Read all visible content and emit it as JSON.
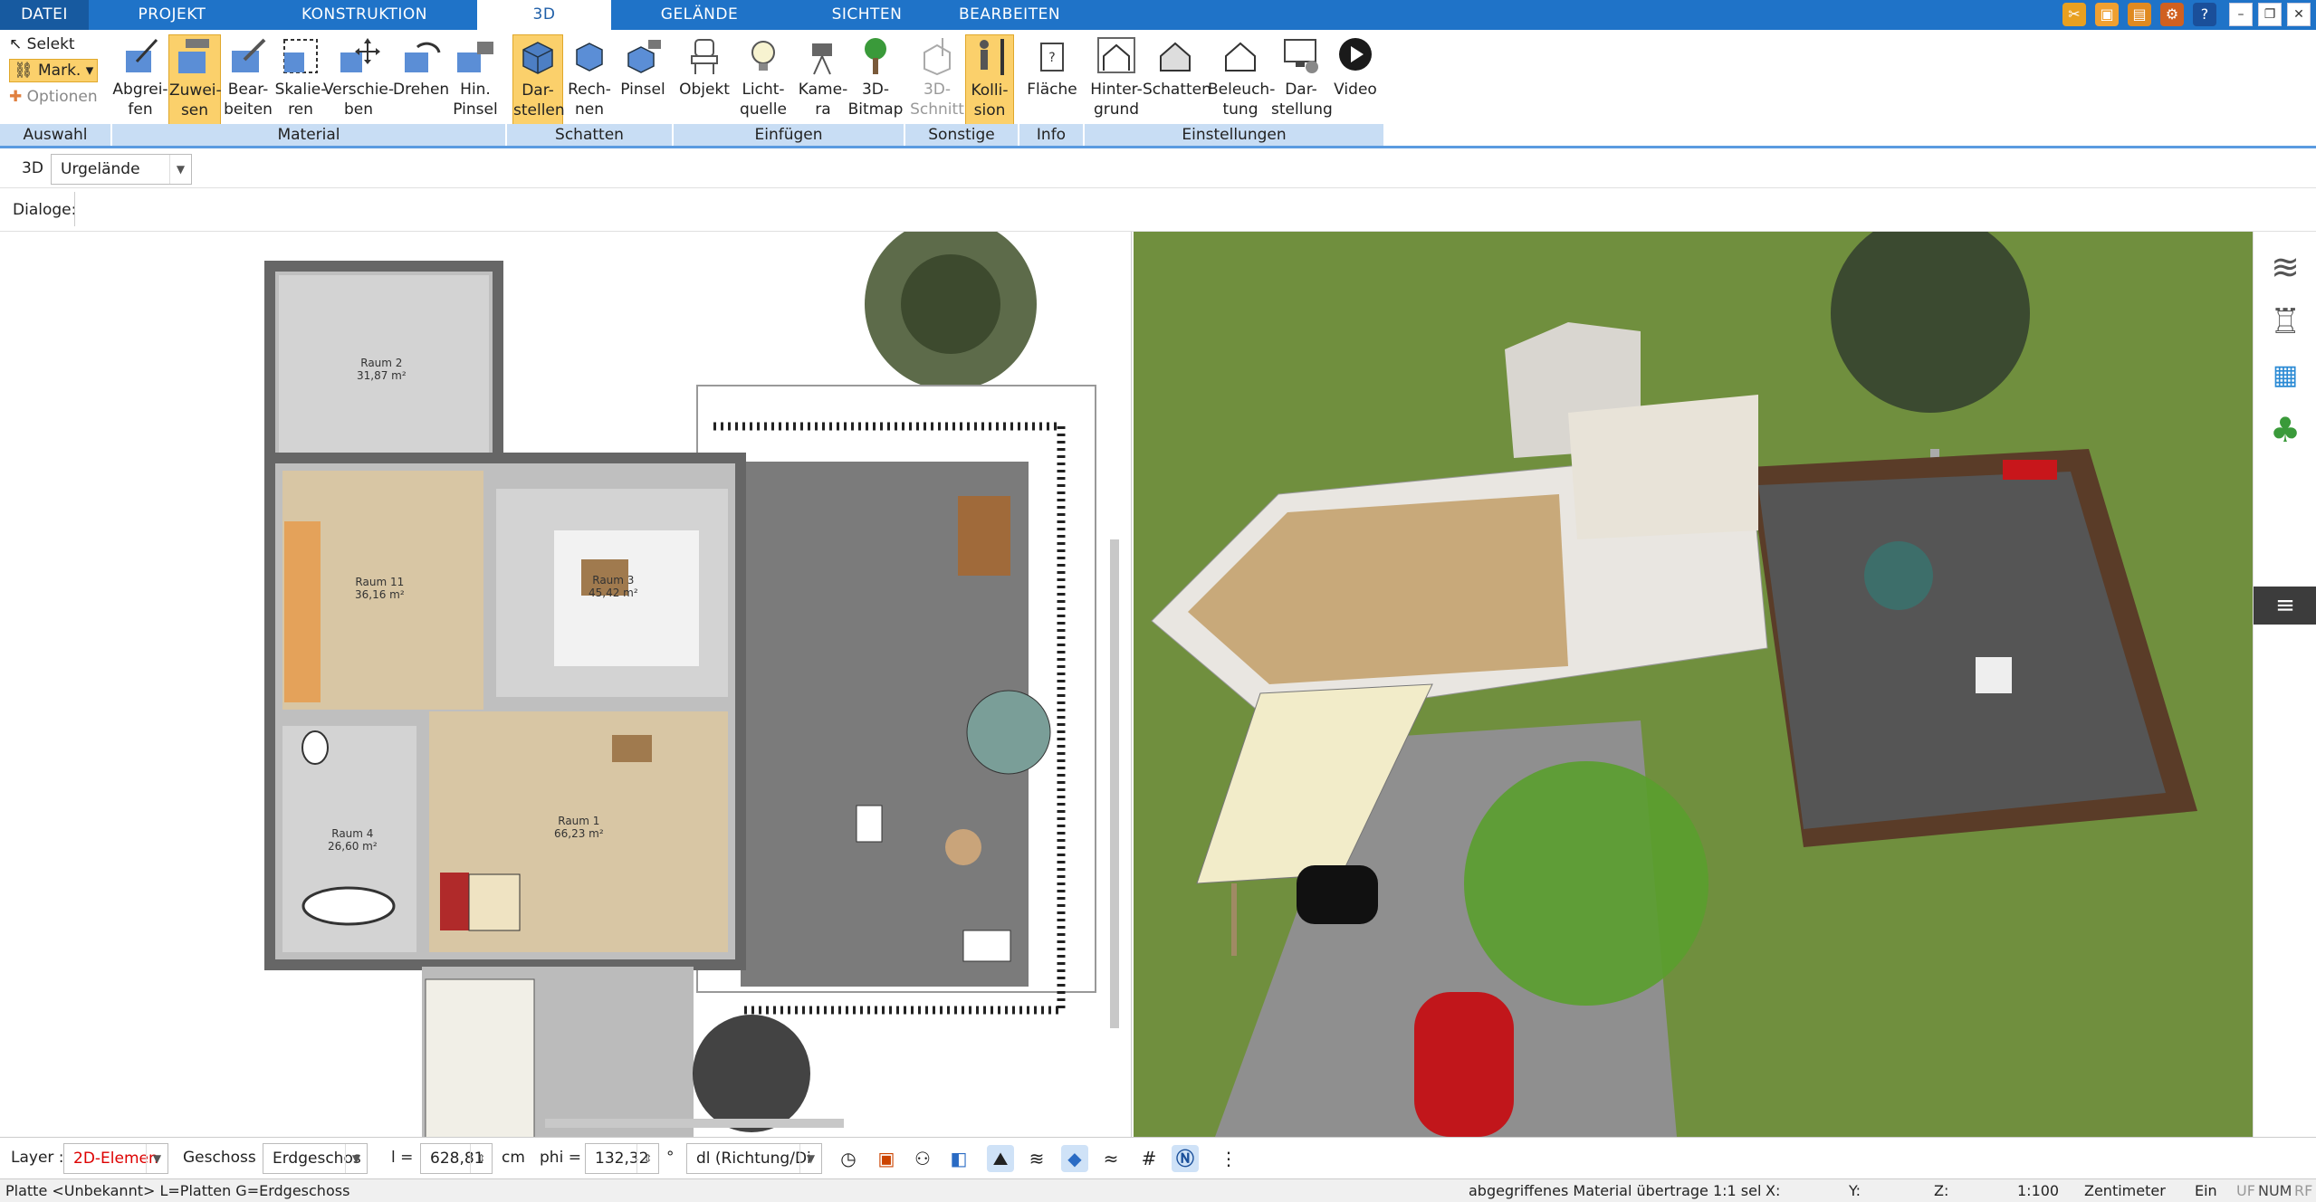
{
  "tabs": [
    {
      "label": "DATEI"
    },
    {
      "label": "PROJEKT"
    },
    {
      "label": "KONSTRUKTION"
    },
    {
      "label": "3D"
    },
    {
      "label": "GELÄNDE"
    },
    {
      "label": "SICHTEN"
    },
    {
      "label": "BEARBEITEN"
    }
  ],
  "ribbon": {
    "auswahl": {
      "selekt": "Selekt",
      "mark": "Mark.",
      "optionen": "Optionen"
    },
    "buttons": [
      {
        "line1": "Abgrei-",
        "line2": "fen"
      },
      {
        "line1": "Zuwei-",
        "line2": "sen"
      },
      {
        "line1": "Bear-",
        "line2": "beiten"
      },
      {
        "line1": "Skalie-",
        "line2": "ren"
      },
      {
        "line1": "Verschie-",
        "line2": "ben"
      },
      {
        "line1": "Drehen",
        "line2": ""
      },
      {
        "line1": "Hin.",
        "line2": "Pinsel"
      },
      {
        "line1": "Dar-",
        "line2": "stellen"
      },
      {
        "line1": "Rech-",
        "line2": "nen"
      },
      {
        "line1": "Pinsel",
        "line2": ""
      },
      {
        "line1": "Objekt",
        "line2": ""
      },
      {
        "line1": "Licht-",
        "line2": "quelle"
      },
      {
        "line1": "Kame-",
        "line2": "ra"
      },
      {
        "line1": "3D-",
        "line2": "Bitmap"
      },
      {
        "line1": "3D-",
        "line2": "Schnitt"
      },
      {
        "line1": "Kolli-",
        "line2": "sion"
      },
      {
        "line1": "Fläche",
        "line2": ""
      },
      {
        "line1": "Hinter-",
        "line2": "grund"
      },
      {
        "line1": "Schatten",
        "line2": ""
      },
      {
        "line1": "Beleuch-",
        "line2": "tung"
      },
      {
        "line1": "Dar-",
        "line2": "stellung"
      },
      {
        "line1": "Video",
        "line2": ""
      }
    ],
    "groups": [
      "Auswahl",
      "Material",
      "Schatten",
      "Einfügen",
      "Sonstige",
      "Info",
      "Einstellungen"
    ]
  },
  "toolbar2": {
    "label": "3D",
    "combo_value": "Urgelände"
  },
  "toolbar3": {
    "label": "Dialoge:"
  },
  "plan": {
    "rooms": [
      {
        "name": "Raum 2",
        "area": "31,87 m²"
      },
      {
        "name": "Raum 11",
        "area": "36,16 m²"
      },
      {
        "name": "Raum 3",
        "area": "45,42 m²"
      },
      {
        "name": "Raum 4",
        "area": "26,60 m²"
      },
      {
        "name": "Raum 1",
        "area": "66,23 m²"
      }
    ]
  },
  "bottombar": {
    "layer_label": "Layer :",
    "layer_value": "2D-Elemen",
    "geschoss_label": "Geschoss :",
    "geschoss_value": "Erdgeschos",
    "l_label": "l =",
    "l_value": "628,81",
    "l_unit": "cm",
    "phi_label": "phi =",
    "phi_value": "132,32",
    "phi_unit": "°",
    "dl_value": "dl (Richtung/Di"
  },
  "status": {
    "left": "Platte <Unbekannt> L=Platten G=Erdgeschoss",
    "msg": "abgegriffenes Material übertrage 1:1 sel",
    "x": "X:",
    "y": "Y:",
    "z": "Z:",
    "scale": "1:100",
    "unit": "Zentimeter",
    "ein": "Ein",
    "uf": "UF",
    "num": "NUM",
    "rf": "RF"
  },
  "colors": {
    "accent": "#1f73c8",
    "active_button": "#fbd06b",
    "group_bar": "#c8ddf4",
    "lawn": "#6b8a3c",
    "terrace": "#5a5a5a"
  }
}
